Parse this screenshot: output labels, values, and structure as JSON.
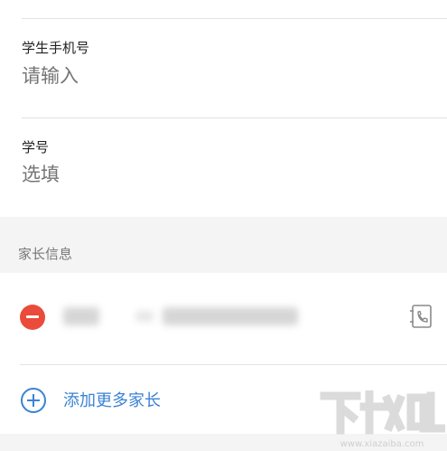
{
  "form": {
    "phone_label": "学生手机号",
    "phone_placeholder": "请输入",
    "student_id_label": "学号",
    "student_id_placeholder": "选填"
  },
  "parents_section": {
    "title": "家长信息",
    "add_label": "添加更多家长"
  },
  "watermark": {
    "text": "下载吧",
    "url": "www.xiazaiba.com"
  },
  "colors": {
    "accent": "#3b83d4",
    "remove": "#ea4b3a"
  }
}
